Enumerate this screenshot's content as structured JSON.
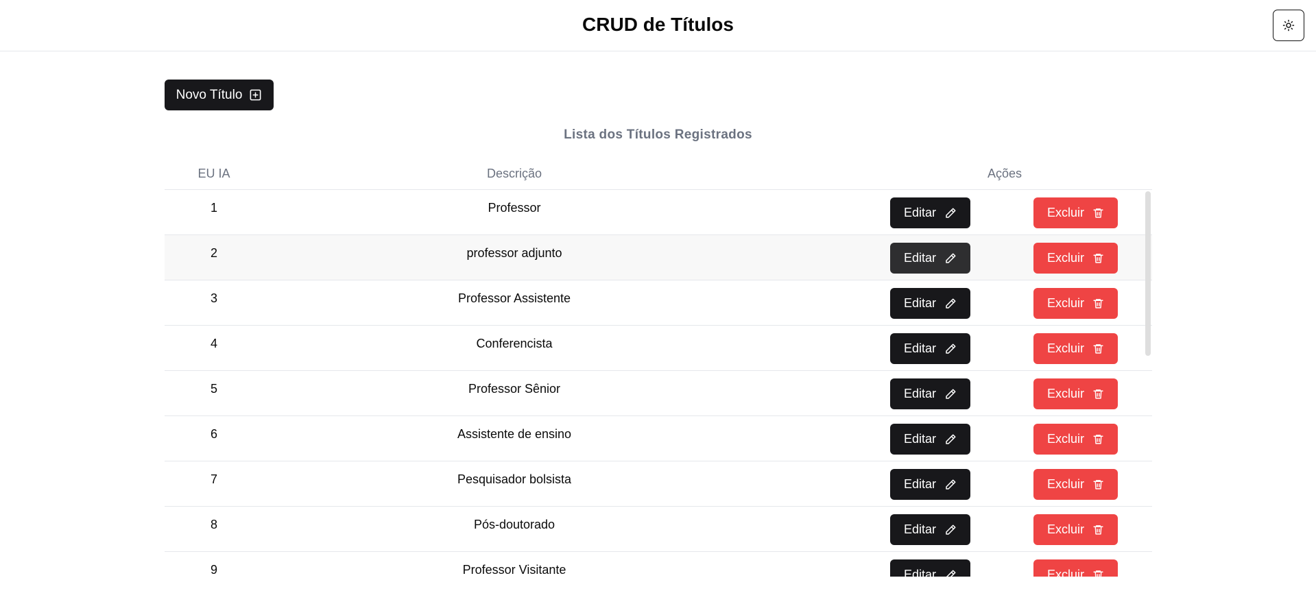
{
  "header": {
    "title": "CRUD de Títulos",
    "theme_icon": "sun-icon"
  },
  "toolbar": {
    "new_label": "Novo Título",
    "new_icon": "plus-square-icon"
  },
  "list": {
    "title": "Lista dos Títulos Registrados",
    "columns": {
      "id": "EU IA",
      "description": "Descrição",
      "actions": "Ações"
    },
    "edit_label": "Editar",
    "delete_label": "Excluir",
    "rows": [
      {
        "id": "1",
        "description": "Professor"
      },
      {
        "id": "2",
        "description": "professor adjunto"
      },
      {
        "id": "3",
        "description": "Professor Assistente"
      },
      {
        "id": "4",
        "description": "Conferencista"
      },
      {
        "id": "5",
        "description": "Professor Sênior"
      },
      {
        "id": "6",
        "description": "Assistente de ensino"
      },
      {
        "id": "7",
        "description": "Pesquisador bolsista"
      },
      {
        "id": "8",
        "description": "Pós-doutorado"
      },
      {
        "id": "9",
        "description": "Professor Visitante"
      }
    ]
  },
  "colors": {
    "primary": "#18181b",
    "danger": "#ef4444",
    "muted": "#6b7280"
  }
}
